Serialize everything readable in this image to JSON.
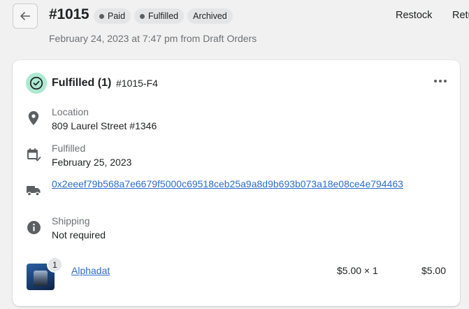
{
  "header": {
    "order_number": "#1015",
    "badges": [
      {
        "label": "Paid",
        "dot": true
      },
      {
        "label": "Fulfilled",
        "dot": true
      },
      {
        "label": "Archived",
        "dot": false
      }
    ],
    "actions": [
      "Restock",
      "Return"
    ],
    "subtitle": "February 24, 2023 at 7:47 pm from Draft Orders"
  },
  "fulfillment": {
    "title": "Fulfilled (1)",
    "id": "#1015-F4",
    "location_label": "Location",
    "location_value": "809 Laurel Street #1346",
    "fulfilled_label": "Fulfilled",
    "fulfilled_value": "February 25, 2023",
    "tracking": "0x2eeef79b568a7e6679f5000c69518ceb25a9a8d9b693b073a18e08ce4e794463",
    "shipping_label": "Shipping",
    "shipping_value": "Not required",
    "line_item": {
      "quantity": "1",
      "name": "Alphadat",
      "unit_price": "$5.00 × 1",
      "total": "$5.00"
    }
  },
  "colors": {
    "success_bg": "#aee9d1",
    "success_icon": "#007f5f",
    "link": "#2c6ecb",
    "icon_gray": "#5c5f62"
  }
}
